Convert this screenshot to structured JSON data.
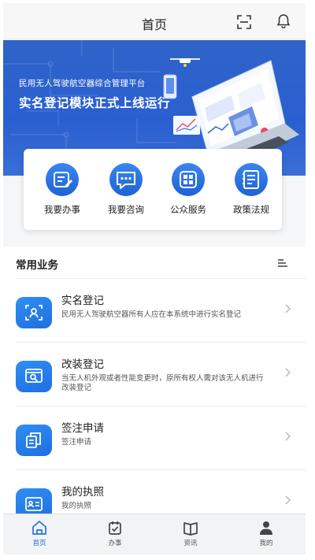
{
  "header": {
    "title": "首页",
    "scan_icon": "scan-icon",
    "bell_icon": "bell-icon"
  },
  "banner": {
    "line1": "民用无人驾驶航空器综合管理平台",
    "line2": "实名登记模块正式上线运行",
    "accent": "#2a5fd0"
  },
  "quick": {
    "items": [
      {
        "label": "我要办事",
        "icon": "edit-icon"
      },
      {
        "label": "我要咨询",
        "icon": "chat-icon"
      },
      {
        "label": "公众服务",
        "icon": "grid-icon"
      },
      {
        "label": "政策法规",
        "icon": "book-icon"
      }
    ]
  },
  "section": {
    "title": "常用业务",
    "menu_icon": "menu-icon"
  },
  "list": [
    {
      "name": "实名登记",
      "desc": "民用无人驾驶航空器所有人应在本系统中进行实名登记",
      "icon": "scan-user-icon"
    },
    {
      "name": "改装登记",
      "desc": "当无人机外观或者性能变更时，原所有权人需对该无人机进行改装登记",
      "icon": "search-form-icon"
    },
    {
      "name": "签注申请",
      "desc": "签注申请",
      "icon": "documents-icon"
    },
    {
      "name": "我的执照",
      "desc": "我的执照",
      "icon": "id-card-icon"
    }
  ],
  "tabs": [
    {
      "label": "首页",
      "icon": "home-icon",
      "active": true
    },
    {
      "label": "办事",
      "icon": "task-icon",
      "active": false
    },
    {
      "label": "资讯",
      "icon": "news-icon",
      "active": false
    },
    {
      "label": "我的",
      "icon": "user-icon",
      "active": false
    }
  ],
  "colors": {
    "primary": "#2b6fd6",
    "icon_gradient_top": "#2f8ef3",
    "icon_gradient_bottom": "#1f6fe0"
  }
}
